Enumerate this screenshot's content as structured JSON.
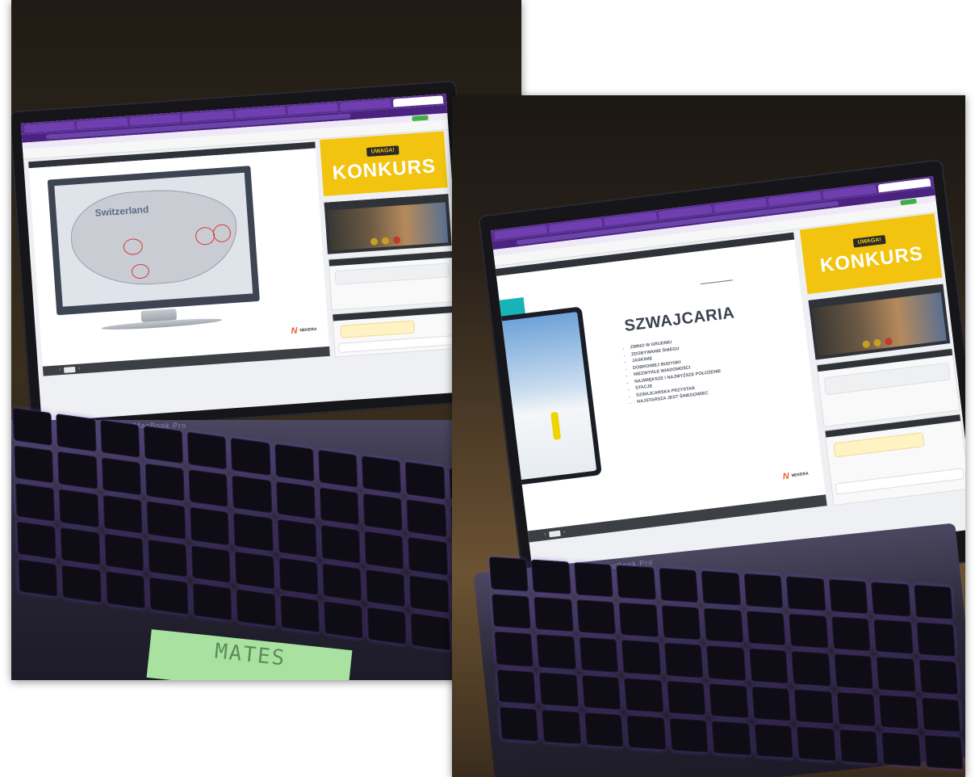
{
  "photos": [
    {
      "id": "left",
      "slide": {
        "type": "map",
        "map_label": "Switzerland",
        "brand_name": "NEKERA"
      },
      "konkurs": {
        "badge": "UWAGA!",
        "title": "KONKURS"
      },
      "laptop_label": "MacBook Pro",
      "sticky_note": "MATES"
    },
    {
      "id": "right",
      "slide": {
        "type": "text",
        "title": "SZWAJCARIA",
        "bullets": [
          "ZIMNO W GRUDNIU",
          "ZDOBYWANIE ŚNIEGU",
          "JASKINIE",
          "DOBROMIEJ BUDYNKI",
          "NIEZWYKŁE WIADOMOŚCI",
          "NAJWIĘKSZE I NAJWYŻSZE POŁOŻENIE",
          "STACJE",
          "SZWAJCARSKA PRZYSTAŃ",
          "NAJSTARSZA JEST ŚNIEGOWIEC"
        ],
        "brand_name": "NEKERA"
      },
      "konkurs": {
        "badge": "UWAGA!",
        "title": "KONKURS"
      },
      "laptop_label": "MacBook Pro"
    }
  ],
  "colors": {
    "browser_purple": "#5a2d92",
    "konkurs_yellow": "#f2c40f",
    "key_glow": "#7846dc",
    "sticky_green": "#a9e2a0"
  }
}
